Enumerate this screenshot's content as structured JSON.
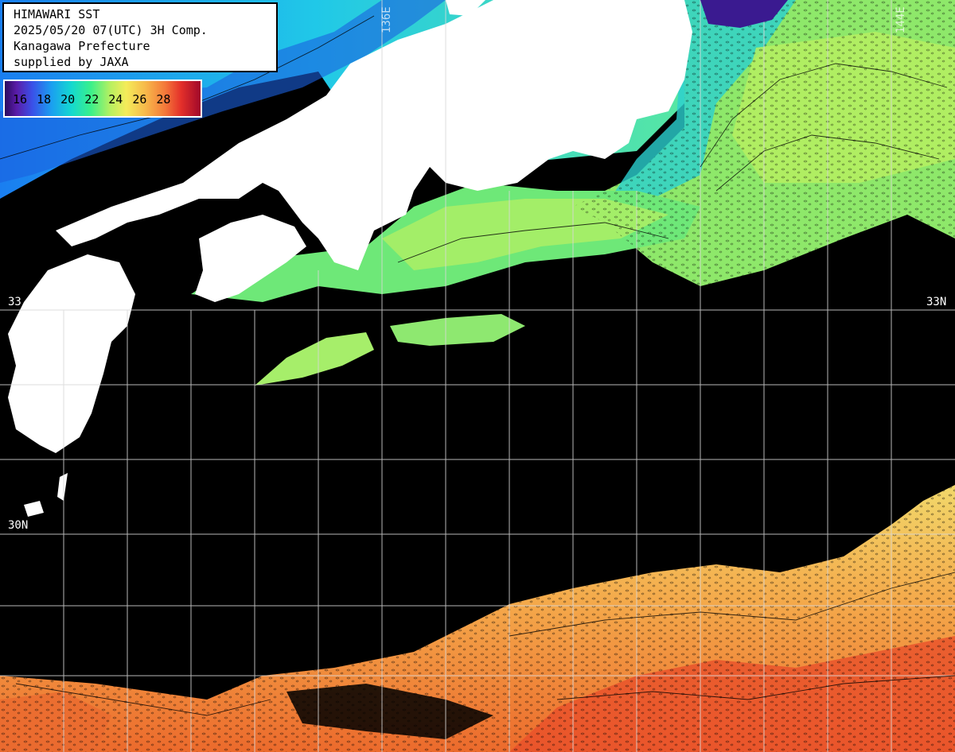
{
  "info": {
    "line1": "HIMAWARI SST",
    "line2": "2025/05/20 07(UTC) 3H Comp.",
    "line3": "Kanagawa Prefecture",
    "line4": "supplied by JAXA"
  },
  "scale": {
    "ticks": [
      "16",
      "18",
      "20",
      "22",
      "24",
      "26",
      "28"
    ]
  },
  "grid_labels": {
    "lat_33_right": "33N",
    "lat_33_left": "33",
    "lat_30_left": "30N",
    "lon_136": "136E",
    "lon_144": "144E"
  },
  "colors": {
    "land": "#ffffff",
    "cloud_nodata": "#000000",
    "grid": "#d8d8d8",
    "cold": "#1e8cf0",
    "mid": "#5ef08a",
    "warm": "#f0c050",
    "hot": "#e8502a"
  }
}
